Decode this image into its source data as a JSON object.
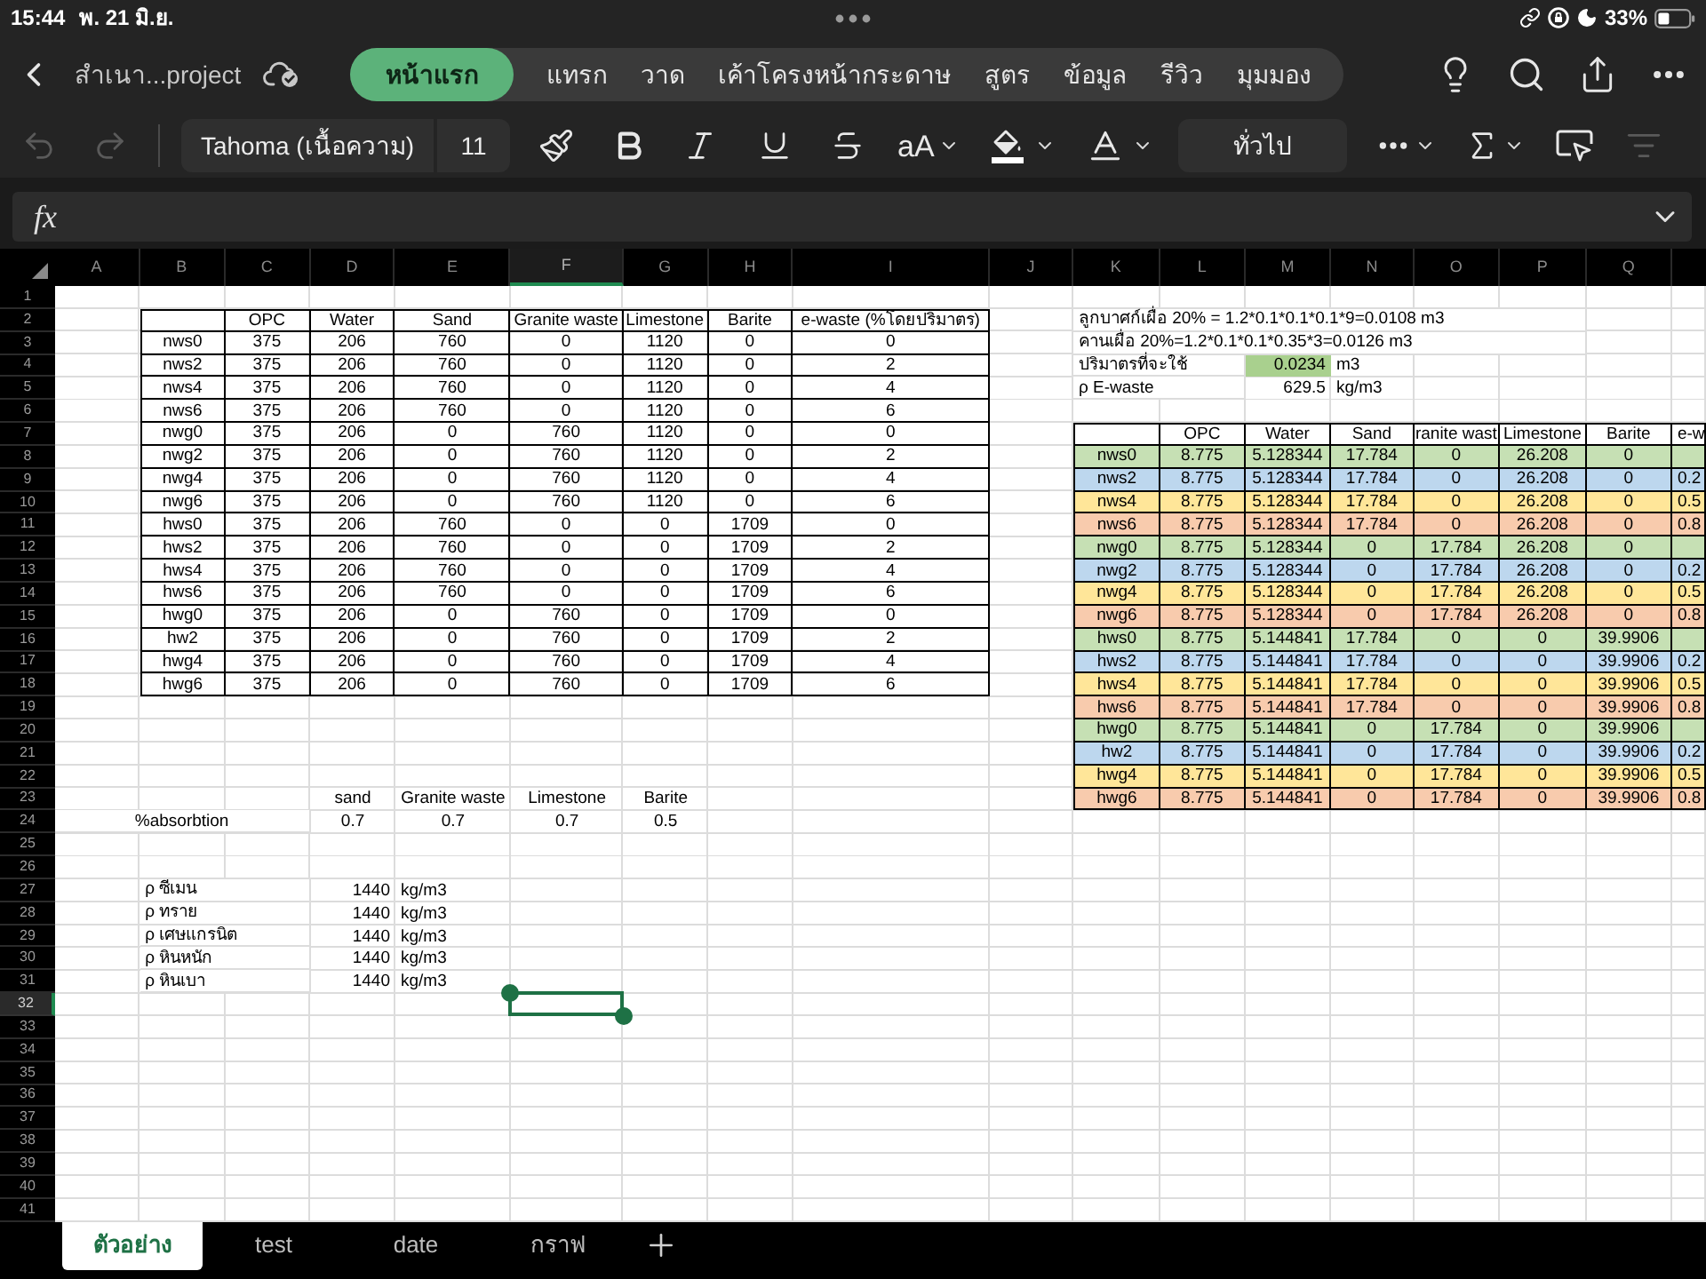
{
  "status_bar": {
    "time": "15:44",
    "date": "พ. 21 มิ.ย.",
    "battery": "33%"
  },
  "title_bar": {
    "file_name": "สำเนา...project",
    "tabs": [
      {
        "label": "หน้าแรก",
        "selected": true
      },
      {
        "label": "แทรก",
        "selected": false
      },
      {
        "label": "วาด",
        "selected": false
      },
      {
        "label": "เค้าโครงหน้ากระดาษ",
        "selected": false
      },
      {
        "label": "สูตร",
        "selected": false
      },
      {
        "label": "ข้อมูล",
        "selected": false
      },
      {
        "label": "รีวิว",
        "selected": false
      },
      {
        "label": "มุมมอง",
        "selected": false
      }
    ]
  },
  "toolbar": {
    "undo_disabled": true,
    "redo_disabled": true,
    "font": "Tahoma (เนื้อความ)",
    "font_size": "11",
    "text_size_menu": "aA",
    "number_format": "ทั่วไป",
    "filter_disabled": true
  },
  "formula_bar": {
    "label": "fx"
  },
  "sheet": {
    "column_headers": [
      {
        "label": "A",
        "selected": false
      },
      {
        "label": "B",
        "selected": false
      },
      {
        "label": "C",
        "selected": false
      },
      {
        "label": "D",
        "selected": false
      },
      {
        "label": "E",
        "selected": false
      },
      {
        "label": "F",
        "selected": true
      },
      {
        "label": "G",
        "selected": false
      },
      {
        "label": "H",
        "selected": false
      },
      {
        "label": "I",
        "selected": false
      },
      {
        "label": "J",
        "selected": false
      },
      {
        "label": "K",
        "selected": false
      },
      {
        "label": "L",
        "selected": false
      },
      {
        "label": "M",
        "selected": false
      },
      {
        "label": "N",
        "selected": false
      },
      {
        "label": "O",
        "selected": false
      },
      {
        "label": "P",
        "selected": false
      },
      {
        "label": "Q",
        "selected": false
      }
    ],
    "row_headers": [
      {
        "label": "1",
        "selected": false
      },
      {
        "label": "2",
        "selected": false
      },
      {
        "label": "3",
        "selected": false
      },
      {
        "label": "4",
        "selected": false
      },
      {
        "label": "5",
        "selected": false
      },
      {
        "label": "6",
        "selected": false
      },
      {
        "label": "7",
        "selected": false
      },
      {
        "label": "8",
        "selected": false
      },
      {
        "label": "9",
        "selected": false
      },
      {
        "label": "10",
        "selected": false
      },
      {
        "label": "11",
        "selected": false
      },
      {
        "label": "12",
        "selected": false
      },
      {
        "label": "13",
        "selected": false
      },
      {
        "label": "14",
        "selected": false
      },
      {
        "label": "15",
        "selected": false
      },
      {
        "label": "16",
        "selected": false
      },
      {
        "label": "17",
        "selected": false
      },
      {
        "label": "18",
        "selected": false
      },
      {
        "label": "19",
        "selected": false
      },
      {
        "label": "20",
        "selected": false
      },
      {
        "label": "21",
        "selected": false
      },
      {
        "label": "22",
        "selected": false
      },
      {
        "label": "23",
        "selected": false
      },
      {
        "label": "24",
        "selected": false
      },
      {
        "label": "25",
        "selected": false
      },
      {
        "label": "26",
        "selected": false
      },
      {
        "label": "27",
        "selected": false
      },
      {
        "label": "28",
        "selected": false
      },
      {
        "label": "29",
        "selected": false
      },
      {
        "label": "30",
        "selected": false
      },
      {
        "label": "31",
        "selected": false
      },
      {
        "label": "32",
        "selected": true
      },
      {
        "label": "33",
        "selected": false
      },
      {
        "label": "34",
        "selected": false
      },
      {
        "label": "35",
        "selected": false
      },
      {
        "label": "36",
        "selected": false
      },
      {
        "label": "37",
        "selected": false
      },
      {
        "label": "38",
        "selected": false
      },
      {
        "label": "39",
        "selected": false
      },
      {
        "label": "40",
        "selected": false
      },
      {
        "label": "41",
        "selected": false
      }
    ],
    "materials_table": {
      "columns": [
        "OPC",
        "Water",
        "Sand",
        "Granite waste",
        "Limestone",
        "Barite",
        "e-waste (%โดยปริมาตร)"
      ],
      "rows": [
        {
          "mix": "nws0",
          "values": [
            "375",
            "206",
            "760",
            "0",
            "1120",
            "0",
            "0"
          ]
        },
        {
          "mix": "nws2",
          "values": [
            "375",
            "206",
            "760",
            "0",
            "1120",
            "0",
            "2"
          ]
        },
        {
          "mix": "nws4",
          "values": [
            "375",
            "206",
            "760",
            "0",
            "1120",
            "0",
            "4"
          ]
        },
        {
          "mix": "nws6",
          "values": [
            "375",
            "206",
            "760",
            "0",
            "1120",
            "0",
            "6"
          ]
        },
        {
          "mix": "nwg0",
          "values": [
            "375",
            "206",
            "0",
            "760",
            "1120",
            "0",
            "0"
          ]
        },
        {
          "mix": "nwg2",
          "values": [
            "375",
            "206",
            "0",
            "760",
            "1120",
            "0",
            "2"
          ]
        },
        {
          "mix": "nwg4",
          "values": [
            "375",
            "206",
            "0",
            "760",
            "1120",
            "0",
            "4"
          ]
        },
        {
          "mix": "nwg6",
          "values": [
            "375",
            "206",
            "0",
            "760",
            "1120",
            "0",
            "6"
          ]
        },
        {
          "mix": "hws0",
          "values": [
            "375",
            "206",
            "760",
            "0",
            "0",
            "1709",
            "0"
          ]
        },
        {
          "mix": "hws2",
          "values": [
            "375",
            "206",
            "760",
            "0",
            "0",
            "1709",
            "2"
          ]
        },
        {
          "mix": "hws4",
          "values": [
            "375",
            "206",
            "760",
            "0",
            "0",
            "1709",
            "4"
          ]
        },
        {
          "mix": "hws6",
          "values": [
            "375",
            "206",
            "760",
            "0",
            "0",
            "1709",
            "6"
          ]
        },
        {
          "mix": "hwg0",
          "values": [
            "375",
            "206",
            "0",
            "760",
            "0",
            "1709",
            "0"
          ]
        },
        {
          "mix": "hw2",
          "values": [
            "375",
            "206",
            "0",
            "760",
            "0",
            "1709",
            "2"
          ]
        },
        {
          "mix": "hwg4",
          "values": [
            "375",
            "206",
            "0",
            "760",
            "0",
            "1709",
            "4"
          ]
        },
        {
          "mix": "hwg6",
          "values": [
            "375",
            "206",
            "0",
            "760",
            "0",
            "1709",
            "6"
          ]
        }
      ]
    },
    "absorption": {
      "columns": [
        "sand",
        "Granite waste",
        "Limestone",
        "Barite"
      ],
      "label": "%absorbtion",
      "values": [
        "0.7",
        "0.7",
        "0.7",
        "0.5"
      ]
    },
    "densities": [
      {
        "label": "ρ ซีเมน",
        "value": "1440",
        "unit": "kg/m3"
      },
      {
        "label": "ρ ทราย",
        "value": "1440",
        "unit": "kg/m3"
      },
      {
        "label": "ρ เศษแกรนิต",
        "value": "1440",
        "unit": "kg/m3"
      },
      {
        "label": "ρ หินหนัก",
        "value": "1440",
        "unit": "kg/m3"
      },
      {
        "label": "ρ หินเบา",
        "value": "1440",
        "unit": "kg/m3"
      }
    ],
    "notes": [
      "ลูกบาศก์เผื่อ 20% = 1.2*0.1*0.1*0.1*9=0.0108 m3",
      "คานเผื่อ 20%=1.2*0.1*0.1*0.35*3=0.0126 m3"
    ],
    "volume": {
      "label": "ปริมาตรที่จะใช้",
      "value": "0.0234",
      "unit": "m3",
      "highlighted": true
    },
    "ewaste_density": {
      "label": "ρ E-waste",
      "value": "629.5",
      "unit": "kg/m3",
      "highlighted": false
    },
    "mix_table": {
      "columns": [
        "OPC",
        "Water",
        "Sand",
        "ranite wast",
        "Limestone",
        "Barite",
        "e-w"
      ],
      "rows": [
        {
          "mix": "nws0",
          "color": "#c6e0b4",
          "values": [
            "8.775",
            "5.128344",
            "17.784",
            "0",
            "26.208",
            "0"
          ]
        },
        {
          "mix": "nws2",
          "color": "#bdd7ee",
          "values": [
            "8.775",
            "5.128344",
            "17.784",
            "0",
            "26.208",
            "0",
            "0.2"
          ]
        },
        {
          "mix": "nws4",
          "color": "#ffe699",
          "values": [
            "8.775",
            "5.128344",
            "17.784",
            "0",
            "26.208",
            "0",
            "0.5"
          ]
        },
        {
          "mix": "nws6",
          "color": "#f8cbad",
          "values": [
            "8.775",
            "5.128344",
            "17.784",
            "0",
            "26.208",
            "0",
            "0.8"
          ]
        },
        {
          "mix": "nwg0",
          "color": "#c6e0b4",
          "values": [
            "8.775",
            "5.128344",
            "0",
            "17.784",
            "26.208",
            "0"
          ]
        },
        {
          "mix": "nwg2",
          "color": "#bdd7ee",
          "values": [
            "8.775",
            "5.128344",
            "0",
            "17.784",
            "26.208",
            "0",
            "0.2"
          ]
        },
        {
          "mix": "nwg4",
          "color": "#ffe699",
          "values": [
            "8.775",
            "5.128344",
            "0",
            "17.784",
            "26.208",
            "0",
            "0.5"
          ]
        },
        {
          "mix": "nwg6",
          "color": "#f8cbad",
          "values": [
            "8.775",
            "5.128344",
            "0",
            "17.784",
            "26.208",
            "0",
            "0.8"
          ]
        },
        {
          "mix": "hws0",
          "color": "#c6e0b4",
          "values": [
            "8.775",
            "5.144841",
            "17.784",
            "0",
            "0",
            "39.9906"
          ]
        },
        {
          "mix": "hws2",
          "color": "#bdd7ee",
          "values": [
            "8.775",
            "5.144841",
            "17.784",
            "0",
            "0",
            "39.9906",
            "0.2"
          ]
        },
        {
          "mix": "hws4",
          "color": "#ffe699",
          "values": [
            "8.775",
            "5.144841",
            "17.784",
            "0",
            "0",
            "39.9906",
            "0.5"
          ]
        },
        {
          "mix": "hws6",
          "color": "#f8cbad",
          "values": [
            "8.775",
            "5.144841",
            "17.784",
            "0",
            "0",
            "39.9906",
            "0.8"
          ]
        },
        {
          "mix": "hwg0",
          "color": "#c6e0b4",
          "values": [
            "8.775",
            "5.144841",
            "0",
            "17.784",
            "0",
            "39.9906"
          ]
        },
        {
          "mix": "hw2",
          "color": "#bdd7ee",
          "values": [
            "8.775",
            "5.144841",
            "0",
            "17.784",
            "0",
            "39.9906",
            "0.2"
          ]
        },
        {
          "mix": "hwg4",
          "color": "#ffe699",
          "values": [
            "8.775",
            "5.144841",
            "0",
            "17.784",
            "0",
            "39.9906",
            "0.5"
          ]
        },
        {
          "mix": "hwg6",
          "color": "#f8cbad",
          "values": [
            "8.775",
            "5.144841",
            "0",
            "17.784",
            "0",
            "39.9906",
            "0.8"
          ]
        }
      ]
    }
  },
  "sheet_tabs": [
    {
      "label": "ตัวอย่าง",
      "selected": true
    },
    {
      "label": "test",
      "selected": false
    },
    {
      "label": "date",
      "selected": false
    },
    {
      "label": "กราฟ",
      "selected": false
    }
  ]
}
